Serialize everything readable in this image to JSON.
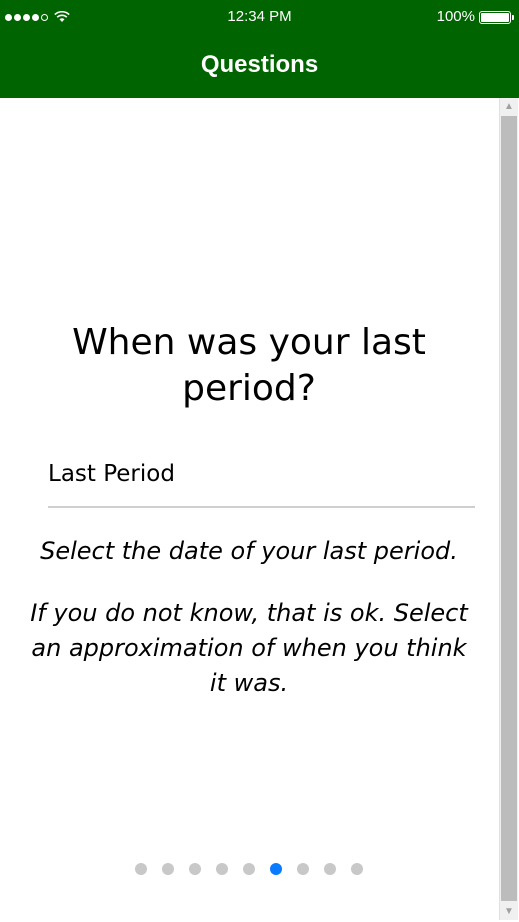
{
  "status_bar": {
    "time": "12:34 PM",
    "battery": "100%",
    "signal_bars_filled": 4,
    "signal_bars_total": 5,
    "icons": [
      "signal-dots",
      "wifi-icon",
      "battery-icon"
    ]
  },
  "nav": {
    "title": "Questions"
  },
  "question": {
    "title": "When was your last period?"
  },
  "field": {
    "label": "Last Period"
  },
  "helper": {
    "line1": "Select the date of your last period.",
    "line2": "If you do not know, that is ok. Select an approximation of when you think it was."
  },
  "pager": {
    "total": 9,
    "active_index": 5
  },
  "colors": {
    "header_bg": "#006400",
    "active_dot": "#0a7aff",
    "inactive_dot": "#c8c8c8"
  }
}
